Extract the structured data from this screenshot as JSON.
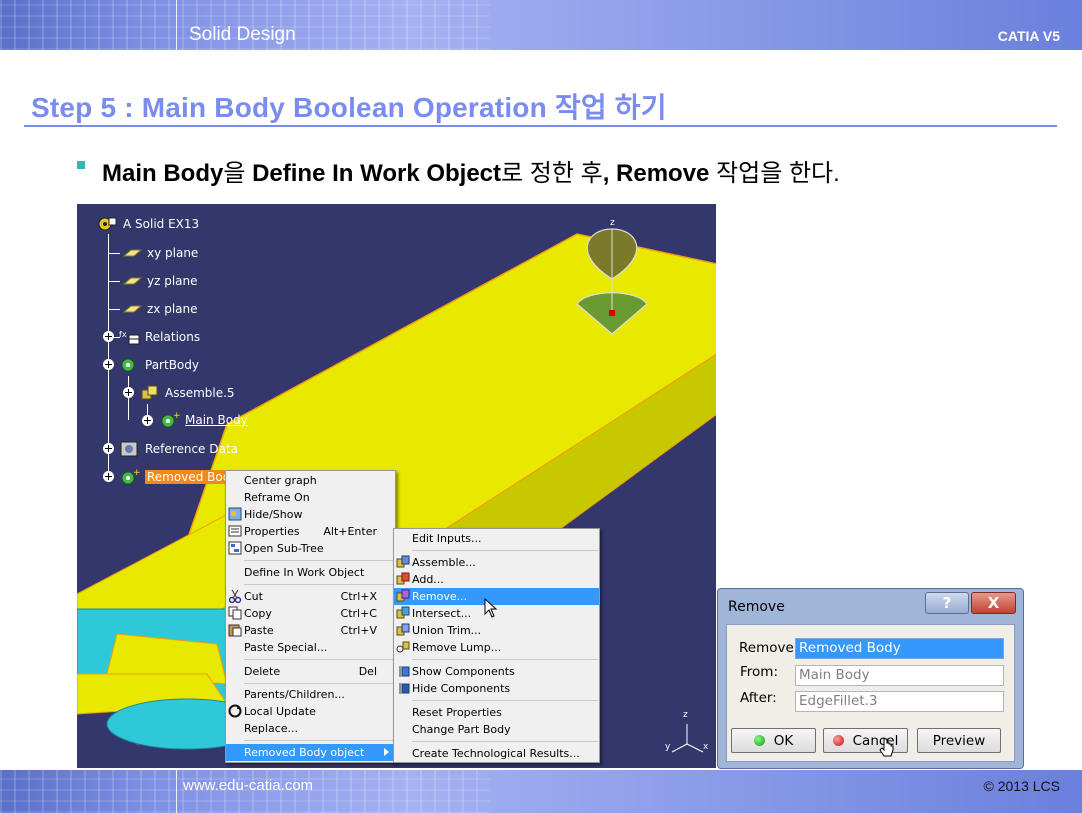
{
  "header": {
    "left": "Solid Design",
    "right": "CATIA V5"
  },
  "footer": {
    "left": "www.edu-catia.com",
    "right": "© 2013 LCS"
  },
  "slide": {
    "title": "Step 5 : Main Body Boolean Operation 작업 하기",
    "bullet": {
      "b1": "Main Body",
      "t1": "을 ",
      "b2": "Define In Work Object",
      "t2": "로 정한 후",
      "b3": ", Remove",
      "t3": " 작업을 한다."
    }
  },
  "tree": {
    "root": "A Solid EX13",
    "items": [
      {
        "label": "xy plane",
        "icon": "plane-icon"
      },
      {
        "label": "yz plane",
        "icon": "plane-icon"
      },
      {
        "label": "zx plane",
        "icon": "plane-icon"
      },
      {
        "label": "Relations",
        "icon": "relations-icon"
      },
      {
        "label": "PartBody",
        "icon": "body-icon"
      },
      {
        "label": "Assemble.5",
        "icon": "assemble-icon"
      },
      {
        "label": "Main Body",
        "icon": "body-icon"
      },
      {
        "label": "Reference Data",
        "icon": "reference-icon"
      },
      {
        "label": "Removed Body",
        "icon": "body-icon"
      }
    ]
  },
  "context_menu": {
    "items": [
      {
        "label": "Center graph",
        "shortcut": ""
      },
      {
        "label": "Reframe On",
        "shortcut": ""
      },
      {
        "label": "Hide/Show",
        "shortcut": "",
        "icon": "hide-show-icon"
      },
      {
        "label": "Properties",
        "shortcut": "Alt+Enter",
        "icon": "properties-icon"
      },
      {
        "label": "Open Sub-Tree",
        "shortcut": "",
        "icon": "subtree-icon"
      },
      {
        "label": "Define In Work Object",
        "shortcut": ""
      },
      {
        "label": "Cut",
        "shortcut": "Ctrl+X",
        "icon": "scissors-icon"
      },
      {
        "label": "Copy",
        "shortcut": "Ctrl+C",
        "icon": "copy-icon"
      },
      {
        "label": "Paste",
        "shortcut": "Ctrl+V",
        "icon": "paste-icon"
      },
      {
        "label": "Paste Special...",
        "shortcut": ""
      },
      {
        "label": "Delete",
        "shortcut": "Del"
      },
      {
        "label": "Parents/Children...",
        "shortcut": ""
      },
      {
        "label": "Local Update",
        "shortcut": "",
        "icon": "update-icon"
      },
      {
        "label": "Replace...",
        "shortcut": ""
      },
      {
        "label": "Removed Body object",
        "shortcut": ""
      }
    ]
  },
  "submenu": {
    "items": [
      {
        "label": "Edit Inputs..."
      },
      {
        "label": "Assemble...",
        "icon": "assemble-icon"
      },
      {
        "label": "Add...",
        "icon": "add-icon"
      },
      {
        "label": "Remove...",
        "icon": "remove-icon"
      },
      {
        "label": "Intersect...",
        "icon": "intersect-icon"
      },
      {
        "label": "Union Trim...",
        "icon": "union-trim-icon"
      },
      {
        "label": "Remove Lump...",
        "icon": "remove-lump-icon"
      },
      {
        "label": "Show Components",
        "icon": "show-components-icon"
      },
      {
        "label": "Hide Components",
        "icon": "hide-components-icon"
      },
      {
        "label": "Reset Properties"
      },
      {
        "label": "Change Part Body"
      },
      {
        "label": "Create Technological Results..."
      }
    ]
  },
  "dialog": {
    "title": "Remove",
    "help": "?",
    "close": "X",
    "fields": [
      {
        "label": "Remove",
        "value": "Removed Body"
      },
      {
        "label": "From:",
        "value": "Main Body"
      },
      {
        "label": "After:",
        "value": "EdgeFillet.3"
      }
    ],
    "buttons": {
      "ok": "OK",
      "cancel": "Cancel",
      "preview": "Preview"
    }
  },
  "viewport": {
    "axis_z": "z",
    "axis_compass_z": "z",
    "axis_compass_y": "y",
    "axis_compass_x": "x"
  },
  "colors": {
    "accent": "#7a8cf0",
    "selection": "#f08a18",
    "menu_highlight": "#3399ff",
    "model_yellow": "#e8e800",
    "background_3d": "#33376b"
  }
}
